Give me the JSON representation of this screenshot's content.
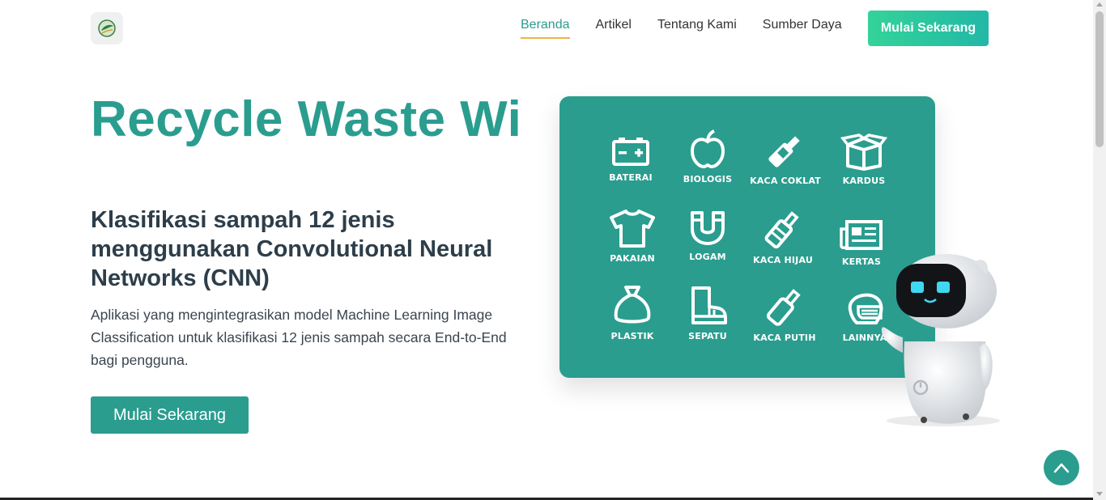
{
  "nav": {
    "links": [
      "Beranda",
      "Artikel",
      "Tentang Kami",
      "Sumber Daya"
    ],
    "active": "Beranda",
    "cta_label": "Mulai Sekarang"
  },
  "hero": {
    "title": "Recycle Waste Wi",
    "subtitle": "Klasifikasi sampah 12 jenis menggunakan Convolutional Neural Networks (CNN)",
    "description": "Aplikasi yang mengintegrasikan model Machine Learning Image Classification untuk klasifikasi 12 jenis sampah secara End-to-End bagi pengguna.",
    "cta_label": "Mulai Sekarang"
  },
  "categories": [
    {
      "label": "BATERAI",
      "icon": "battery-icon"
    },
    {
      "label": "BIOLOGIS",
      "icon": "apple-icon"
    },
    {
      "label": "KACA COKLAT",
      "icon": "bottle-icon"
    },
    {
      "label": "KARDUS",
      "icon": "box-icon"
    },
    {
      "label": "PAKAIAN",
      "icon": "shirt-icon"
    },
    {
      "label": "LOGAM",
      "icon": "magnet-icon"
    },
    {
      "label": "KACA HIJAU",
      "icon": "bottle-icon"
    },
    {
      "label": "KERTAS",
      "icon": "newspaper-icon"
    },
    {
      "label": "PLASTIK",
      "icon": "bag-icon"
    },
    {
      "label": "SEPATU",
      "icon": "boot-icon"
    },
    {
      "label": "KACA PUTIH",
      "icon": "bottle-icon"
    },
    {
      "label": "LAINNYA",
      "icon": "mask-icon"
    }
  ],
  "colors": {
    "accent": "#2a9d8f",
    "underline": "#e9b44c",
    "cta_gradient_start": "#34d399",
    "cta_gradient_end": "#22b8a6"
  }
}
